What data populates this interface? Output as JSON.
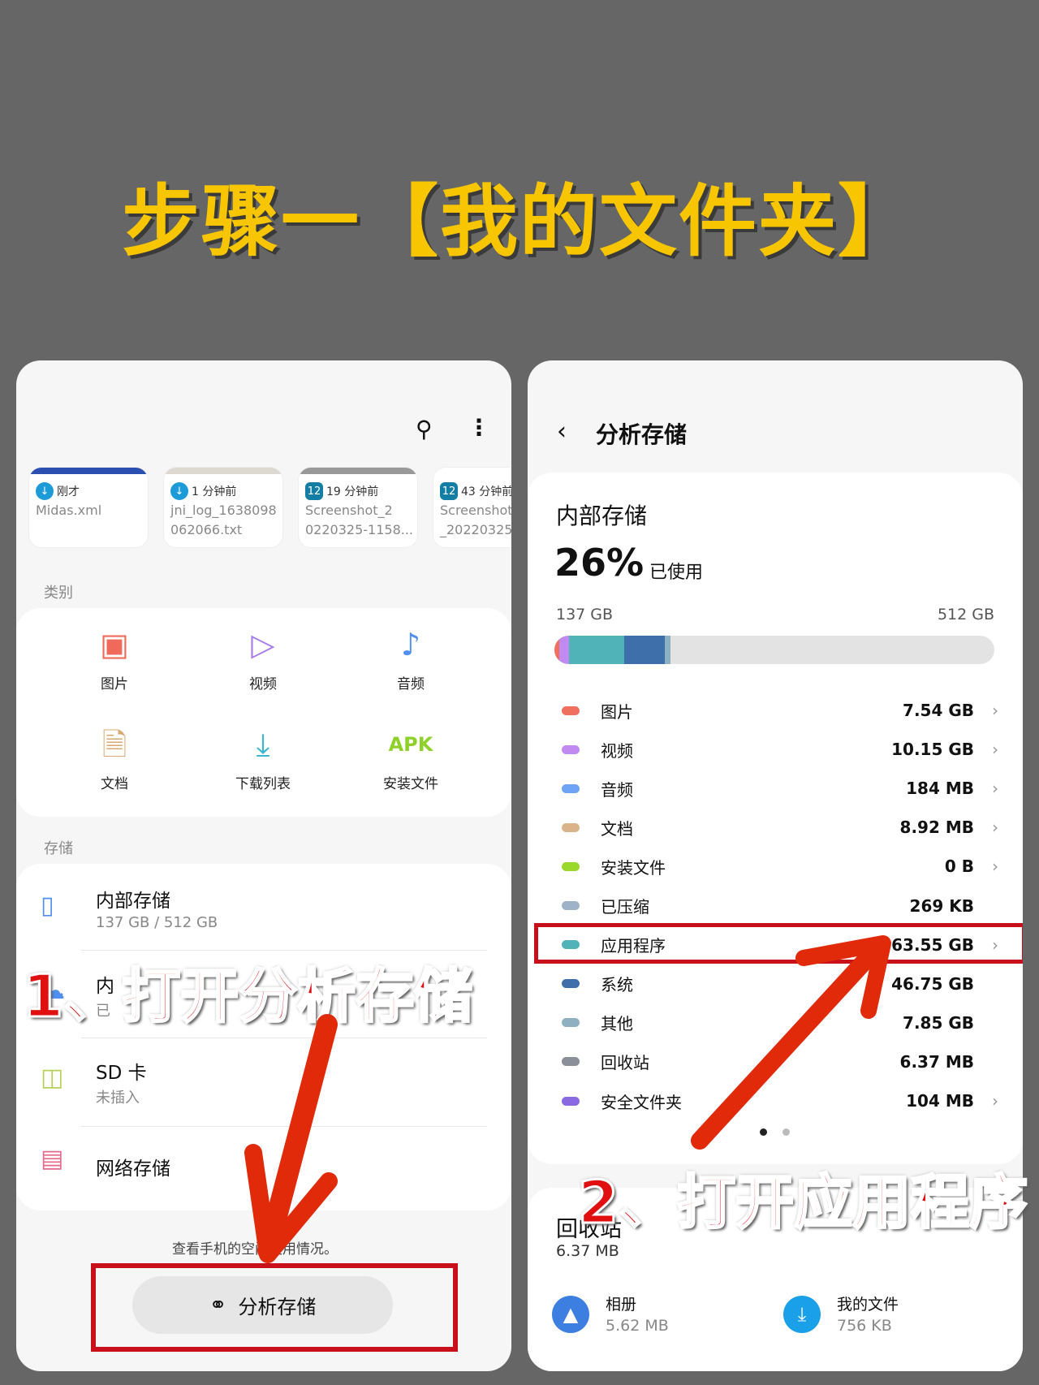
{
  "title": "步骤一【我的文件夹】",
  "left": {
    "recent": [
      {
        "time": "刚才",
        "name": [
          "Midas.xml",
          ""
        ],
        "icon": "download-icon",
        "bar": "#2a4fb0"
      },
      {
        "time": "1 分钟前",
        "name": [
          "jni_log_1638098",
          "062066.txt"
        ],
        "icon": "download-icon",
        "bar": "#ddd8d0"
      },
      {
        "time": "19 分钟前",
        "name": [
          "Screenshot_2",
          "0220325-1158..."
        ],
        "icon": "screenshot-icon",
        "bar": "#999"
      },
      {
        "time": "43 分钟前",
        "name": [
          "Screenshot",
          "_20220325"
        ],
        "icon": "screenshot-icon",
        "bar": "#fff"
      }
    ],
    "categories_label": "类别",
    "categories": [
      {
        "label": "图片",
        "icon": "image-icon",
        "color": "#ef6a5a"
      },
      {
        "label": "视频",
        "icon": "video-icon",
        "color": "#a77be8"
      },
      {
        "label": "音频",
        "icon": "music-icon",
        "color": "#4f8ff0"
      },
      {
        "label": "文档",
        "icon": "document-icon",
        "color": "#d8a870"
      },
      {
        "label": "下载列表",
        "icon": "download-icon",
        "color": "#3bb5d0"
      },
      {
        "label": "安装文件",
        "icon": "apk-icon",
        "color": "#8fd12a",
        "glyph": "APK"
      }
    ],
    "storage_label": "存储",
    "storage": [
      {
        "title": "内部存储",
        "sub": "137 GB / 512 GB",
        "icon": "phone-icon"
      },
      {
        "title": "内",
        "sub": "已",
        "icon": "cloud-icon"
      },
      {
        "title": "SD 卡",
        "sub": "未插入",
        "icon": "sd-card-icon"
      },
      {
        "title": "网络存储",
        "sub": "",
        "icon": "network-storage-icon"
      }
    ],
    "hint": "查看手机的空间使用情况。",
    "analyze_button": "分析存储",
    "annotation": "1、打开分析存储"
  },
  "right": {
    "header": "分析存储",
    "internal": "内部存储",
    "percent": "26%",
    "used_label": "已使用",
    "used": "137 GB",
    "total": "512 GB",
    "usage_fraction": 0.26,
    "items": [
      {
        "label": "图片",
        "value": "7.54 GB",
        "color": "#f07060",
        "chev": true
      },
      {
        "label": "视频",
        "value": "10.15 GB",
        "color": "#c08af0",
        "chev": true
      },
      {
        "label": "音频",
        "value": "184 MB",
        "color": "#6fa3f5",
        "chev": true
      },
      {
        "label": "文档",
        "value": "8.92 MB",
        "color": "#d9b48a",
        "chev": true
      },
      {
        "label": "安装文件",
        "value": "0 B",
        "color": "#9ad82c",
        "chev": true
      },
      {
        "label": "已压缩",
        "value": "269 KB",
        "color": "#9fb3c8",
        "chev": false
      },
      {
        "label": "应用程序",
        "value": "63.55 GB",
        "color": "#4fb3b8",
        "chev": true
      },
      {
        "label": "系统",
        "value": "46.75 GB",
        "color": "#3f6faa",
        "chev": false
      },
      {
        "label": "其他",
        "value": "7.85 GB",
        "color": "#8fb0c0",
        "chev": false
      },
      {
        "label": "回收站",
        "value": "6.37 MB",
        "color": "#8a8f99",
        "chev": false
      },
      {
        "label": "安全文件夹",
        "value": "104 MB",
        "color": "#8a6ae0",
        "chev": true
      }
    ],
    "trash": {
      "title": "回收站",
      "size": "6.37 MB"
    },
    "apps": [
      {
        "name": "相册",
        "size": "5.62 MB",
        "icon": "gallery-icon",
        "color": "#3d7fe0"
      },
      {
        "name": "我的文件",
        "size": "756 KB",
        "icon": "my-files-icon",
        "color": "#1aa0e8"
      }
    ],
    "annotation": "2、打开应用程序"
  }
}
